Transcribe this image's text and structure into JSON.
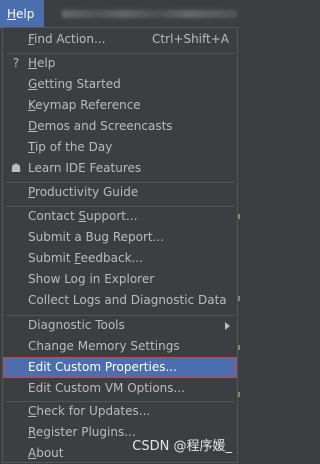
{
  "menubar": {
    "help": {
      "first": "H",
      "rest": "elp"
    }
  },
  "menu": {
    "find_action": {
      "mn": "F",
      "rest": "ind Action...",
      "shortcut": "Ctrl+Shift+A"
    },
    "help": {
      "mn": "H",
      "rest": "elp",
      "icon": "?"
    },
    "getting_started": {
      "mn": "G",
      "rest": "etting Started"
    },
    "keymap_reference": {
      "mn": "K",
      "rest": "eymap Reference"
    },
    "demos": {
      "mn": "D",
      "rest": "emos and Screencasts"
    },
    "tip": {
      "mn": "T",
      "rest": "ip of the Day"
    },
    "learn": {
      "label": "Learn IDE Features",
      "icon": "☗"
    },
    "productivity": {
      "mn": "P",
      "rest": "roductivity Guide"
    },
    "contact_support": {
      "pre": "Contact ",
      "mn": "S",
      "rest": "upport..."
    },
    "bug_report": {
      "label": "Submit a Bug Report..."
    },
    "feedback": {
      "pre": "Submit ",
      "mn": "F",
      "rest": "eedback..."
    },
    "show_log": {
      "label": "Show Log in Explorer"
    },
    "collect_logs": {
      "label": "Collect Logs and Diagnostic Data"
    },
    "diagnostic_tools": {
      "label": "Diagnostic Tools"
    },
    "change_memory": {
      "label": "Change Memory Settings"
    },
    "edit_custom_props": {
      "label": "Edit Custom Properties..."
    },
    "edit_custom_vm": {
      "label": "Edit Custom VM Options..."
    },
    "check_updates": {
      "mn": "C",
      "rest": "heck for Updates..."
    },
    "register_plugins": {
      "mn": "R",
      "rest": "egister Plugins..."
    },
    "about": {
      "mn": "A",
      "rest": "bout"
    }
  },
  "watermark": "CSDN @程序媛_",
  "colors": {
    "background": "#3c3f41",
    "selection": "#4b6eaf",
    "highlight_border": "#e83a3a",
    "text": "#bbbbbb"
  }
}
